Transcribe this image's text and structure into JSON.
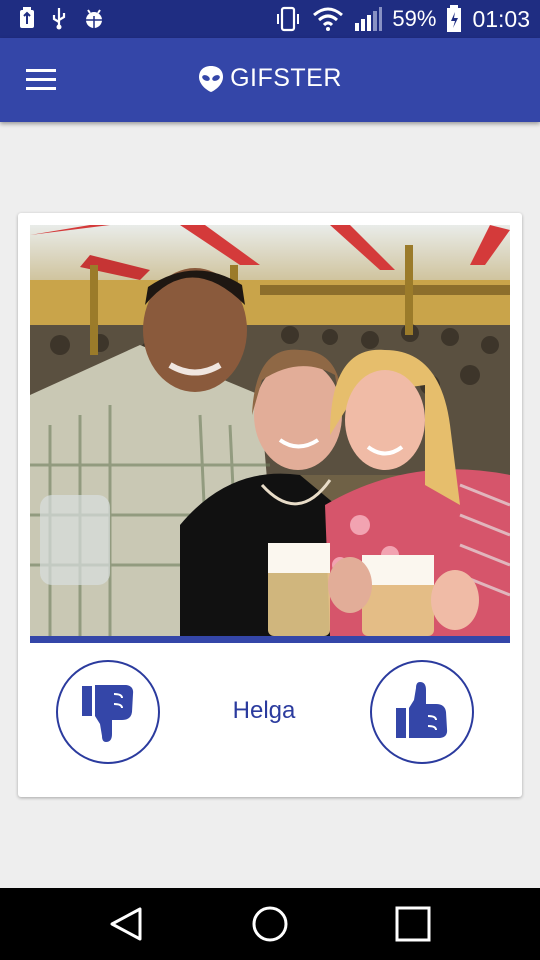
{
  "status_bar": {
    "battery_percent": "59%",
    "time": "01:03",
    "left_icons": [
      "usb-icon",
      "usb-icon",
      "android-debug-icon"
    ],
    "right_icons": [
      "vibrate-icon",
      "wifi-icon",
      "signal-icon",
      "battery-charging-icon"
    ]
  },
  "app_bar": {
    "title": "GIFSTER",
    "menu_icon": "hamburger-menu-icon",
    "logo_icon": "alien-head-icon"
  },
  "card": {
    "photo": "photo of three people holding beer mugs in a festival tent",
    "name": "Helga",
    "dislike_icon": "thumbs-down-icon",
    "like_icon": "thumbs-up-icon"
  },
  "nav_bar": {
    "icons": [
      "back-icon",
      "home-icon",
      "recents-icon"
    ]
  },
  "colors": {
    "status_bar": "#1f2d82",
    "app_bar": "#3446a8",
    "accent": "#2b3b9e",
    "background": "#eeeeee",
    "card": "#ffffff",
    "nav_bar": "#000000"
  }
}
